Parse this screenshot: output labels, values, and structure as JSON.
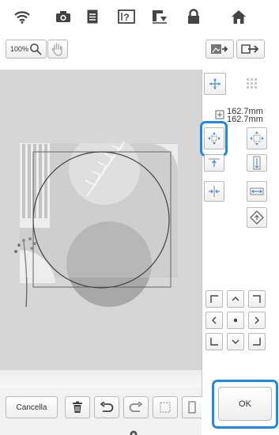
{
  "topbar": {
    "icons": [
      "wifi-icon",
      "camera-icon",
      "document-icon",
      "help-icon",
      "embroidery-sewing-icon",
      "lock-icon",
      "home-icon"
    ]
  },
  "toolbar": {
    "zoom_label": "100%",
    "zoom_icon": "magnifier-icon",
    "hand_icon": "hand-icon"
  },
  "panel": {
    "dimension_width": "162.7mm",
    "dimension_height": "162.7mm",
    "ok_label": "OK"
  },
  "bottombar": {
    "cancel_label": "Cancella"
  },
  "colors": {
    "accent": "#1e88e5",
    "canvas": "#d6d6d6"
  }
}
